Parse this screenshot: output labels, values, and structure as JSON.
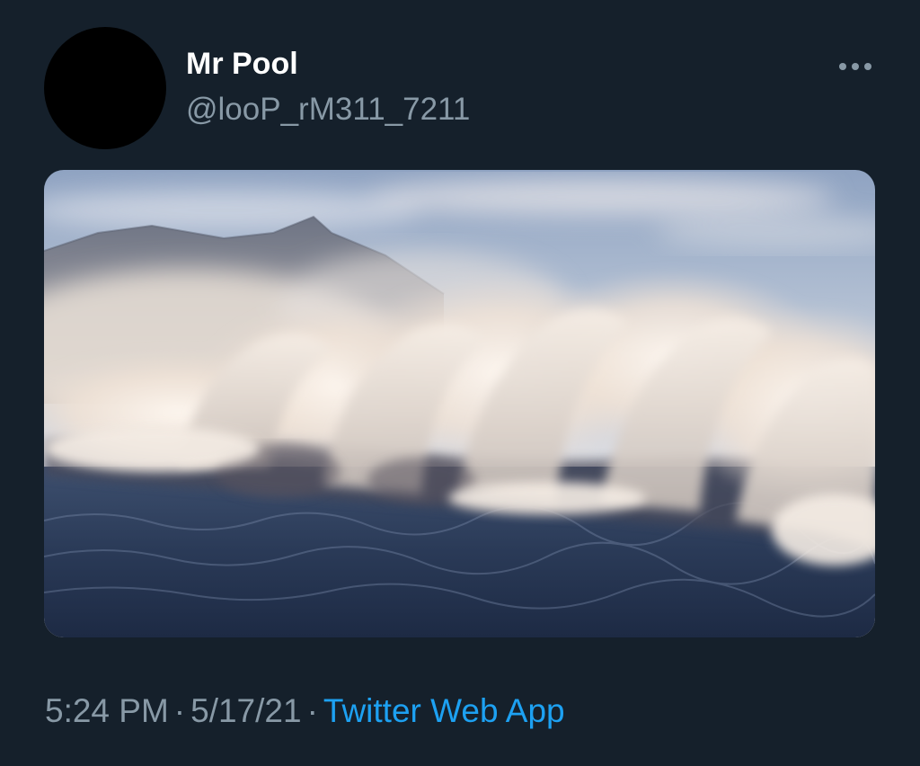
{
  "tweet": {
    "author": {
      "display_name": "Mr Pool",
      "handle": "@looP_rM311_7211"
    },
    "more_icon": "more-horizontal-icon",
    "image_subject": "wave",
    "time": "5:24 PM",
    "separator": "·",
    "date": "5/17/21",
    "source": "Twitter Web App"
  },
  "colors": {
    "background": "#15202b",
    "text_primary": "#ffffff",
    "text_secondary": "#8899a6",
    "link": "#1da1f2"
  }
}
